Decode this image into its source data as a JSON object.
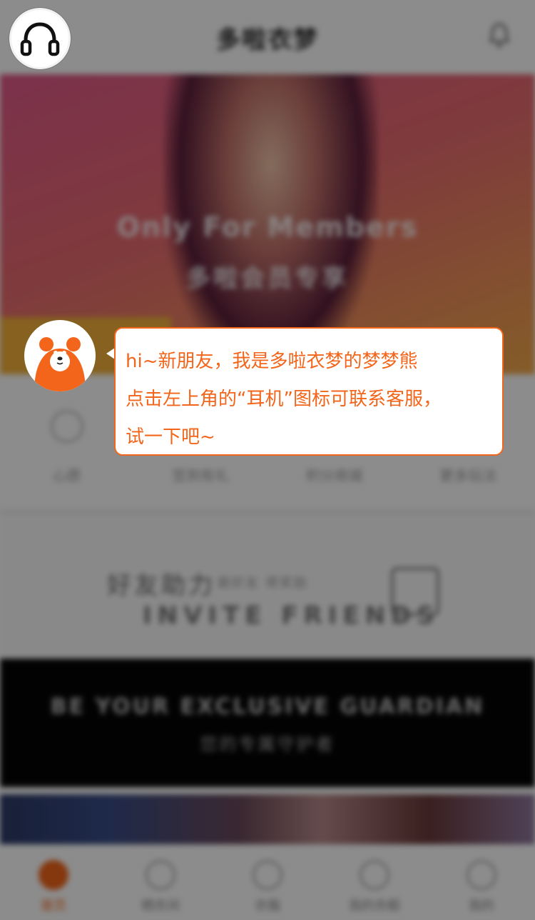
{
  "header": {
    "title": "多啦衣梦"
  },
  "banner": {
    "title_en": "Only For Members",
    "title_cn": "多啦会员专享"
  },
  "quick_menu": [
    {
      "label": "心愿"
    },
    {
      "label": "签到有礼"
    },
    {
      "label": "积分商城"
    },
    {
      "label": "更多玩法"
    }
  ],
  "invite": {
    "title_cn": "好友助力",
    "subtitle": "邀好友 得奖励",
    "title_en": "INVITE FRIENDS"
  },
  "guardian": {
    "title_en": "BE YOUR EXCLUSIVE GUARDIAN",
    "subtitle_cn": "您的专属守护者"
  },
  "tabbar": [
    {
      "label": "首页",
      "icon": "home-icon",
      "active": true
    },
    {
      "label": "晒衣间",
      "icon": "hanger-edit-icon",
      "active": false
    },
    {
      "label": "衣箱",
      "icon": "cloud-icon",
      "active": false
    },
    {
      "label": "我的衣橱",
      "icon": "wardrobe-icon",
      "active": false
    },
    {
      "label": "我的",
      "icon": "person-icon",
      "active": false
    }
  ],
  "guide": {
    "lines": [
      "hi~新朋友，我是多啦衣梦的梦梦熊",
      "点击左上角的“耳机”图标可联系客服，",
      "试一下吧~"
    ],
    "mascot_icon": "bear-mascot-icon",
    "accent": "#f2651a"
  },
  "headset_icon": "headphones-icon"
}
